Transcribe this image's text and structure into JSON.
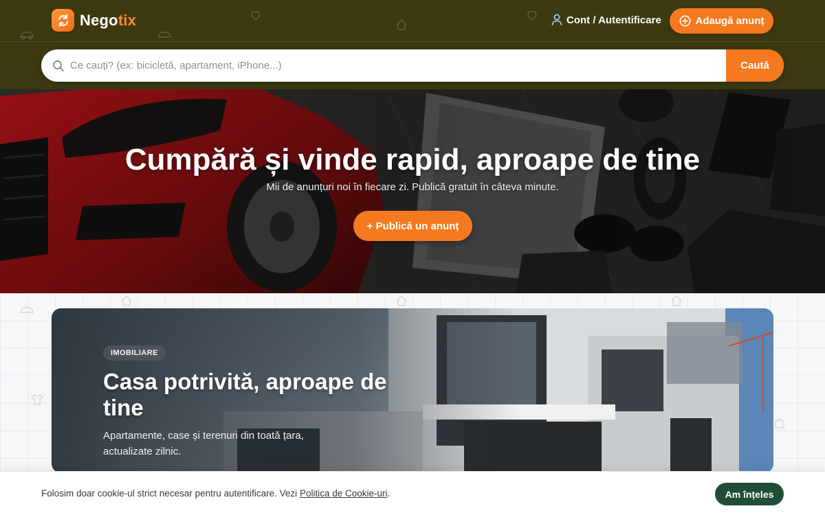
{
  "brand": {
    "name_main": "Nego",
    "name_accent": "tix",
    "logo_icon": "refresh-icon",
    "accent_color": "#f57a1f"
  },
  "header": {
    "account_label": "Cont / Autentificare",
    "add_listing_label": "Adaugă anunț"
  },
  "search": {
    "placeholder": "Ce cauți? (ex: bicicletă, apartament, iPhone...)",
    "value": "",
    "button_label": "Caută"
  },
  "hero": {
    "title": "Cumpără și vinde rapid, aproape de tine",
    "subtitle": "Mii de anunțuri noi în fiecare zi. Publică gratuit în câteva minute.",
    "cta_label": "+ Publică un anunț"
  },
  "feature_card": {
    "badge": "IMOBILIARE",
    "title": "Casa potrivită, aproape de tine",
    "description": "Apartamente, case și terenuri din toată țara, actualizate zilnic."
  },
  "cookie_banner": {
    "text_before": "Folosim doar cookie-ul strict necesar pentru autentificare. Vezi ",
    "link_label": "Politica de Cookie-uri",
    "text_after": ".",
    "accept_label": "Am înțeles"
  }
}
